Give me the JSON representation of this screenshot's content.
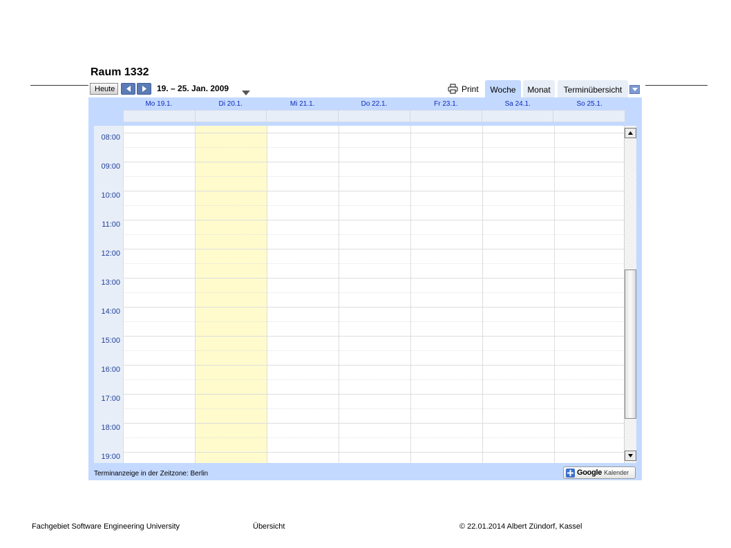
{
  "title": "Raum 1332",
  "toolbar": {
    "today_label": "Heute",
    "date_range": "19. – 25. Jan. 2009",
    "print_label": "Print"
  },
  "tabs": [
    {
      "label": "Woche",
      "active": true
    },
    {
      "label": "Monat",
      "active": false
    },
    {
      "label": "Terminübersicht",
      "active": false
    }
  ],
  "days": [
    {
      "label": "Mo 19.1.",
      "today": false
    },
    {
      "label": "Di 20.1.",
      "today": true
    },
    {
      "label": "Mi 21.1.",
      "today": false
    },
    {
      "label": "Do 22.1.",
      "today": false
    },
    {
      "label": "Fr 23.1.",
      "today": false
    },
    {
      "label": "Sa 24.1.",
      "today": false
    },
    {
      "label": "So 25.1.",
      "today": false
    }
  ],
  "hours": [
    "08:00",
    "09:00",
    "10:00",
    "11:00",
    "12:00",
    "13:00",
    "14:00",
    "15:00",
    "16:00",
    "17:00",
    "18:00",
    "19:00"
  ],
  "timezone_note": "Terminanzeige in der Zeitzone: Berlin",
  "badge": {
    "brand": "Google",
    "product": "Kalender"
  },
  "colors": {
    "frame": "#c3d9ff",
    "today": "#fffbcc",
    "header_text": "#112abb"
  },
  "footer": {
    "department": "Fachgebiet Software Engineering University",
    "overview": "Übersicht",
    "copyright": "© 22.01.2014 Albert Zündorf, Kassel"
  }
}
